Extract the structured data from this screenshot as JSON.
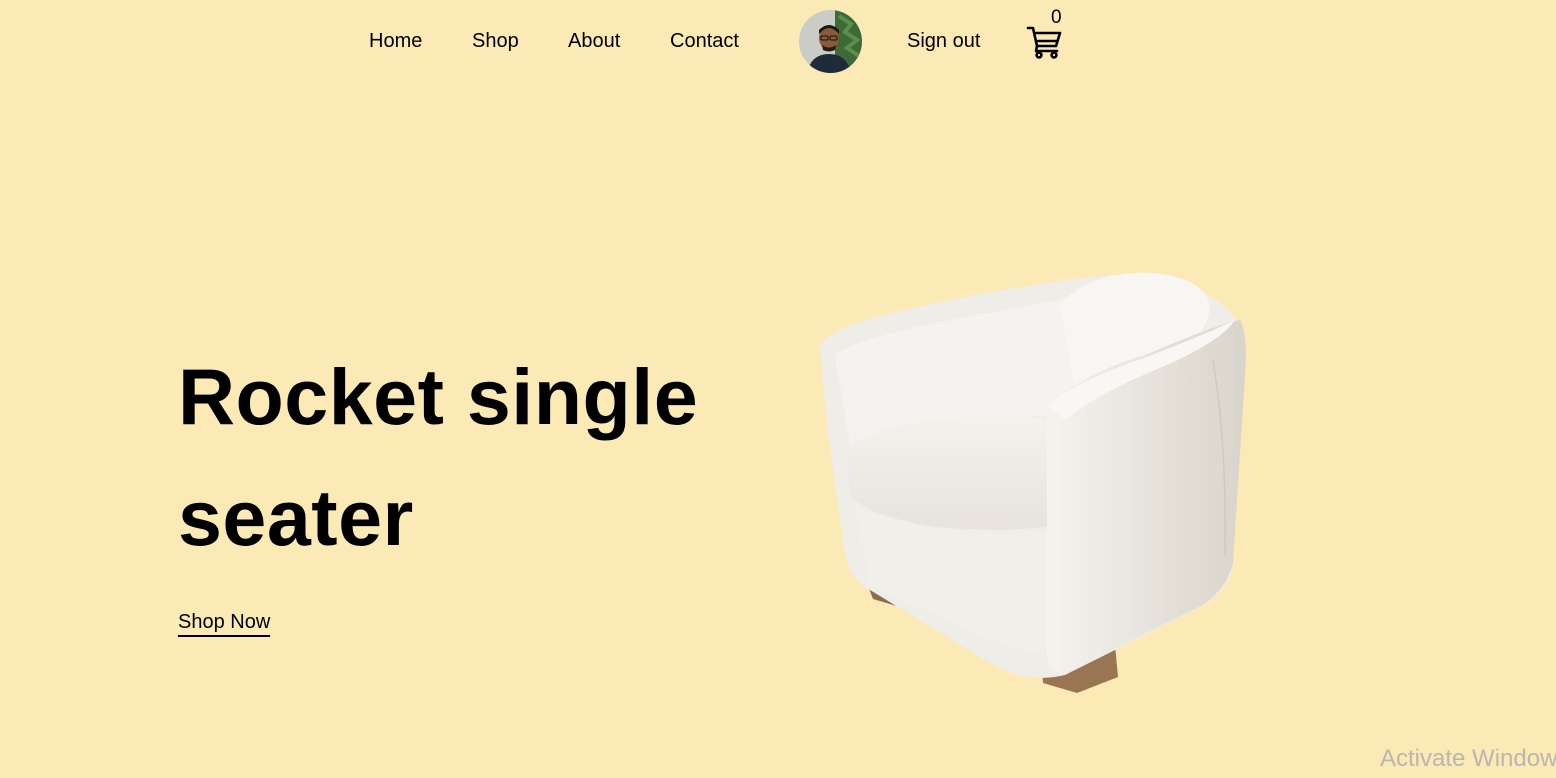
{
  "nav": {
    "links": [
      "Home",
      "Shop",
      "About",
      "Contact"
    ],
    "signout_label": "Sign out",
    "cart_count": "0",
    "cart_icon": "cart-icon",
    "avatar_icon": "avatar"
  },
  "hero": {
    "title": "Rocket single seater",
    "cta_label": "Shop Now",
    "product_image": "armchair-image"
  },
  "system": {
    "watermark": "Activate Windows"
  },
  "colors": {
    "background": "#fbeab5",
    "text": "#000000"
  }
}
